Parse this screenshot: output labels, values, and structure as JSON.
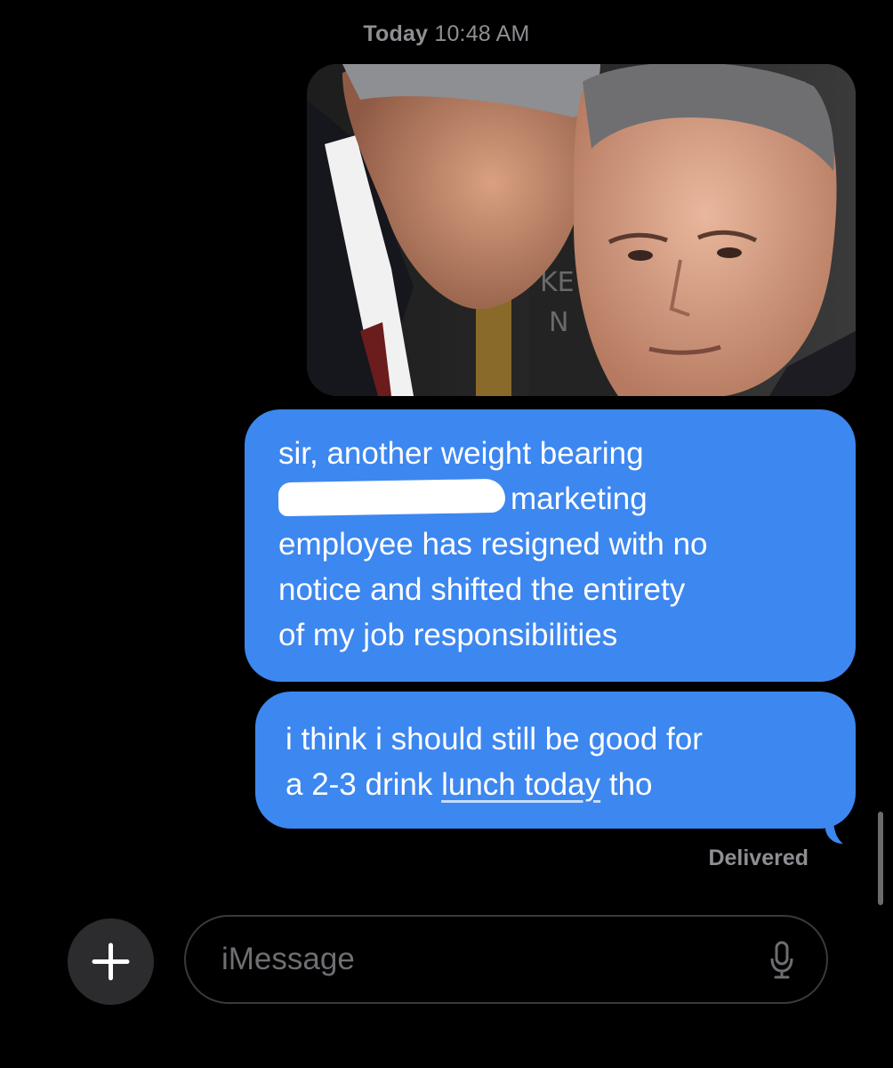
{
  "thread": {
    "timestamp_day": "Today",
    "timestamp_time": "10:48 AM"
  },
  "messages": [
    {
      "type": "image",
      "sender": "me",
      "description_icon": "photo-attachment"
    },
    {
      "type": "text",
      "sender": "me",
      "line1": "sir, another weight bearing",
      "line2_after_redaction": "marketing",
      "line3": "employee has resigned with no",
      "line4": "notice and shifted the entirety",
      "line5": "of my job responsibilities"
    },
    {
      "type": "text",
      "sender": "me",
      "line1": "i think i should still be good for",
      "line2_prefix": "a 2-3 drink ",
      "line2_link": "lunch today",
      "line2_suffix": " tho"
    }
  ],
  "status": {
    "delivered": "Delivered"
  },
  "composer": {
    "placeholder": "iMessage",
    "plus_icon": "plus-icon",
    "mic_icon": "microphone-icon"
  },
  "colors": {
    "background": "#000000",
    "bubble_blue": "#3d87f0",
    "secondary_text": "#8e8e93",
    "field_border": "#3a3a3c"
  }
}
